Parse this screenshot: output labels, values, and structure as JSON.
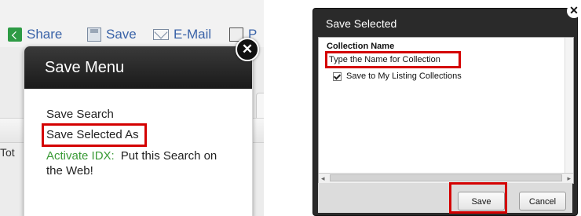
{
  "left": {
    "toolbar": {
      "share_label": "Share",
      "save_label": "Save",
      "email_label": "E-Mail",
      "print_label": "P"
    },
    "background_text": "Tot",
    "save_menu": {
      "title": "Save Menu",
      "items": [
        "Save Search",
        "Save Selected As"
      ],
      "activate_link": "Activate IDX:",
      "activate_text": "Put this Search on the Web!",
      "close_glyph": "✕"
    }
  },
  "right": {
    "dialog": {
      "title": "Save Selected",
      "close_glyph": "✕",
      "collection_label": "Collection Name",
      "collection_value": "Type the Name for Collection",
      "checkbox_label": "Save to My Listing Collections",
      "checkbox_checked": true,
      "save_button": "Save",
      "cancel_button": "Cancel",
      "scroll_left": "◂",
      "scroll_right": "▸"
    }
  },
  "colors": {
    "highlight": "#d40000",
    "link_blue": "#3a63a8",
    "idx_green": "#3a9a36",
    "header_dark": "#1a1a1a"
  }
}
